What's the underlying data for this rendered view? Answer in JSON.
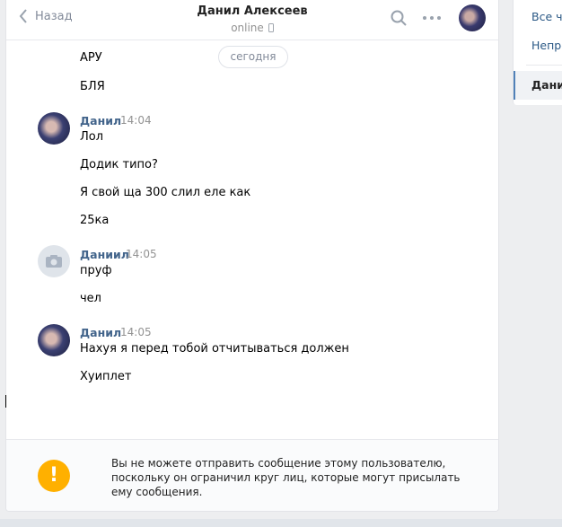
{
  "header": {
    "back_label": "Назад",
    "name": "Данил Алексеев",
    "status": "online"
  },
  "date_divider": "сегодня",
  "messages": [
    {
      "lines": [
        "АРУ",
        "БЛЯ"
      ]
    },
    {
      "author": "Данил",
      "time": "14:04",
      "avatar": "photo",
      "lines": [
        "Лол",
        "Додик типо?",
        "Я свой ща 300 слил еле как",
        "25ка"
      ]
    },
    {
      "author": "Даниил",
      "time": "14:05",
      "avatar": "camera-icon",
      "lines": [
        "пруф",
        "чел"
      ]
    },
    {
      "author": "Данил",
      "time": "14:05",
      "avatar": "photo",
      "lines": [
        "Нахуя я перед тобой отчитываться должен",
        "Хуиплет"
      ]
    }
  ],
  "footer": {
    "warning_icon_glyph": "!",
    "warning_text": "Вы не можете отправить сообщение этому пользователю, поскольку он ограничил круг лиц, которые могут присылать ему сообщения."
  },
  "right_menu": {
    "items": [
      "Все ча",
      "Непро"
    ],
    "active": "Данил"
  },
  "colors": {
    "accent": "#42648b",
    "link": "#2a5885",
    "warning": "#ffb000"
  }
}
